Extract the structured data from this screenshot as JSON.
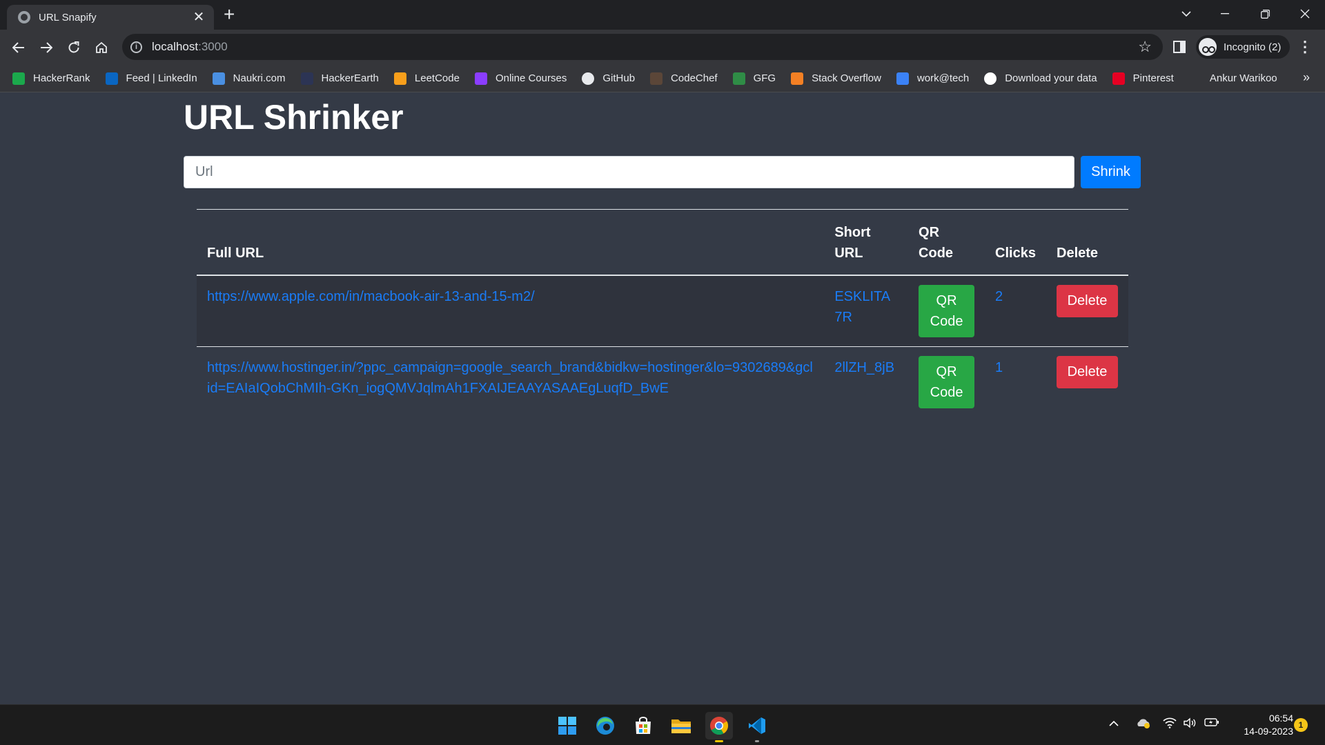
{
  "browser": {
    "tab_title": "URL Snapify",
    "tab_close": "✕",
    "new_tab": "+",
    "url_host": "localhost",
    "url_port": ":3000",
    "profile_label": "Incognito (2)",
    "bookmarks": [
      {
        "label": "HackerRank",
        "icon": "HR",
        "color": "#1ba94c"
      },
      {
        "label": "Feed | LinkedIn",
        "icon": "in",
        "color": "#0a66c2"
      },
      {
        "label": "Naukri.com",
        "icon": "N",
        "color": "#4a90e2"
      },
      {
        "label": "HackerEarth",
        "icon": "HE",
        "color": "#2c3454"
      },
      {
        "label": "LeetCode",
        "icon": "L",
        "color": "#f89f1b"
      },
      {
        "label": "Online Courses",
        "icon": "U",
        "color": "#8b3dff"
      },
      {
        "label": "GitHub",
        "icon": "GH",
        "color": "#e8eaed"
      },
      {
        "label": "CodeChef",
        "icon": "CC",
        "color": "#5b4638"
      },
      {
        "label": "GFG",
        "icon": "G",
        "color": "#2f8d46"
      },
      {
        "label": "Stack Overflow",
        "icon": "SO",
        "color": "#f48024"
      },
      {
        "label": "work@tech",
        "icon": "@",
        "color": "#3b82f6"
      },
      {
        "label": "Download your data",
        "icon": "G",
        "color": "#ffffff"
      },
      {
        "label": "Pinterest",
        "icon": "P",
        "color": "#e60023"
      },
      {
        "label": "Ankur Warikoo",
        "icon": "wv",
        "color": "#35363a"
      }
    ],
    "bookmarks_more": "»"
  },
  "app": {
    "title": "URL Shrinker",
    "input_placeholder": "Url",
    "input_value": "",
    "shrink_label": "Shrink",
    "table": {
      "headers": {
        "full_url": "Full URL",
        "short_url": "Short URL",
        "qr_code": "QR Code",
        "clicks": "Clicks",
        "delete": "Delete"
      },
      "rows": [
        {
          "full_url": "https://www.apple.com/in/macbook-air-13-and-15-m2/",
          "short_url": "ESKLITA7R",
          "qr_label": "QR Code",
          "clicks": "2",
          "delete_label": "Delete"
        },
        {
          "full_url": "https://www.hostinger.in/?ppc_campaign=google_search_brand&bidkw=hostinger&lo=9302689&gclid=EAIaIQobChMIh-GKn_iogQMVJqlmAh1FXAIJEAAYASAAEgLuqfD_BwE",
          "short_url": "2llZH_8jB",
          "qr_label": "QR Code",
          "clicks": "1",
          "delete_label": "Delete"
        }
      ]
    }
  },
  "taskbar": {
    "time": "06:54",
    "date": "14-09-2023",
    "notification_count": "1"
  }
}
